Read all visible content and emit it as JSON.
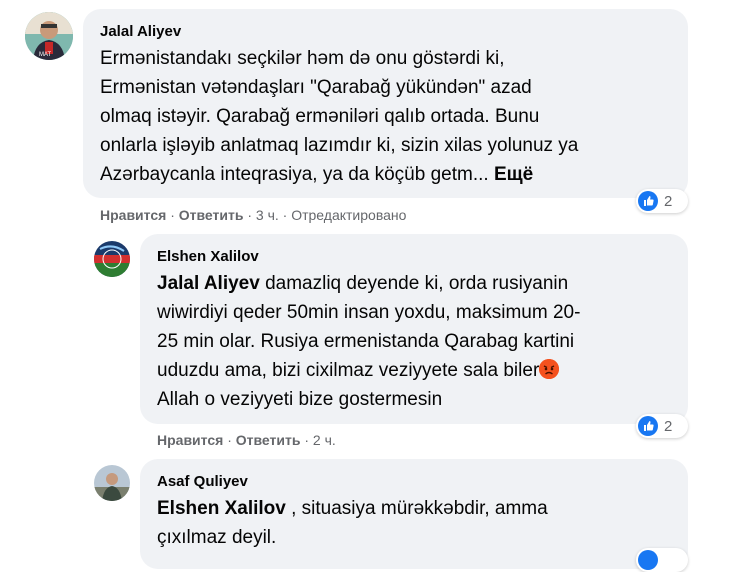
{
  "comments": [
    {
      "author": "Jalal Aliyev",
      "lines": [
        "Ermənistandakı seçkilər həm də onu göstərdi ki,",
        "Ermənistan vətəndaşları \"Qarabağ yükündən\" azad",
        "olmaq istəyir. Qarabağ erməniləri qalıb ortada. Bunu",
        "onlarla işləyib anlatmaq lazımdır ki, sizin xilas yolunuz ya",
        "Azərbaycanla inteqrasiya, ya da köçüb getm..."
      ],
      "see_more": "Ещё",
      "like_label": "Нравится",
      "reply_label": "Ответить",
      "time": "3 ч.",
      "edited": "Отредактировано",
      "reaction_count": "2"
    },
    {
      "author": "Elshen Xalilov",
      "mention": "Jalal Aliyev",
      "lines": [
        " damazliq deyende ki, orda rusiyanin",
        "wiwirdiyi qeder 50min insan yoxdu, maksimum 20-",
        "25 min olar. Rusiya ermenistanda Qarabag kartini",
        "uduzdu ama, bizi cixilmaz veziyyete sala biler",
        "Allah o veziyyeti bize gostermesin"
      ],
      "emoji": "angry-face-emoji",
      "like_label": "Нравится",
      "reply_label": "Ответить",
      "time": "2 ч.",
      "reaction_count": "2"
    },
    {
      "author": "Asaf Quliyev",
      "mention": "Elshen Xalilov",
      "lines": [
        " , situasiya mürəkkəbdir, amma",
        "çıxılmaz deyil."
      ]
    }
  ],
  "colors": {
    "bubble": "#f0f2f5",
    "secondary_text": "#65676b",
    "like_blue": "#1877f2"
  },
  "separator": "·"
}
